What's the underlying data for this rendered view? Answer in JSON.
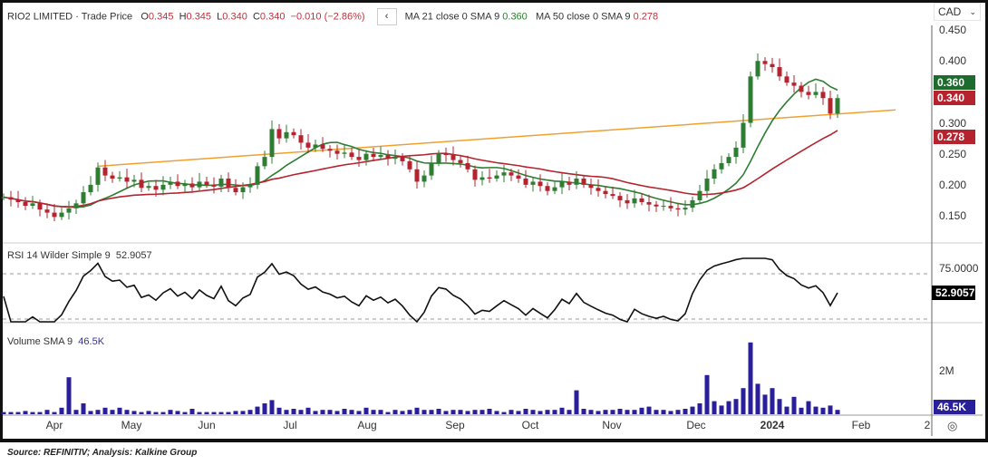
{
  "header": {
    "symbol": "RIO2 LIMITED",
    "sep": "·",
    "type": "Trade Price",
    "o_label": "O",
    "o": "0.345",
    "h_label": "H",
    "h": "0.345",
    "l_label": "L",
    "l": "0.340",
    "c_label": "C",
    "c": "0.340",
    "change": "−0.010 (−2.86%)",
    "collapse_icon": "chevron-left-icon",
    "ma21_label": "MA 21 close 0 SMA 9",
    "ma21_value": "0.360",
    "ma50_label": "MA 50 close 0 SMA 9",
    "ma50_value": "0.278"
  },
  "currency": "CAD",
  "rsi": {
    "label": "RSI 14 Wilder Simple 9",
    "value": "52.9057",
    "axis": [
      "75.0000"
    ]
  },
  "volume": {
    "label": "Volume SMA 9",
    "value": "46.5K",
    "axis": [
      "2M"
    ]
  },
  "price_axis": [
    "0.450",
    "0.400",
    "0.300",
    "0.250",
    "0.200",
    "0.150"
  ],
  "price_tags": {
    "ma21": "0.360",
    "last": "0.340",
    "ma50": "0.278"
  },
  "months": [
    "Apr",
    "May",
    "Jun",
    "Jul",
    "Aug",
    "Sep",
    "Oct",
    "Nov",
    "Dec",
    "2024",
    "Feb",
    "2"
  ],
  "settings_icon": "gear-icon",
  "source": "Source: REFINITIV; Analysis: Kalkine Group",
  "colors": {
    "up": "#2e7d32",
    "down": "#b5232e",
    "ma21": "#2e7d32",
    "ma50": "#b5232e",
    "trend": "#f0a030",
    "volume": "#2a1f9a"
  },
  "chart_data": {
    "type": "candlestick",
    "title": "RIO2 LIMITED · Trade Price",
    "ylim": [
      0.13,
      0.46
    ],
    "close": [
      0.18,
      0.176,
      0.172,
      0.166,
      0.17,
      0.16,
      0.155,
      0.148,
      0.155,
      0.162,
      0.17,
      0.188,
      0.2,
      0.228,
      0.215,
      0.21,
      0.212,
      0.205,
      0.208,
      0.195,
      0.198,
      0.192,
      0.2,
      0.205,
      0.198,
      0.202,
      0.196,
      0.205,
      0.2,
      0.197,
      0.21,
      0.195,
      0.188,
      0.196,
      0.2,
      0.23,
      0.245,
      0.29,
      0.275,
      0.285,
      0.28,
      0.268,
      0.26,
      0.265,
      0.258,
      0.255,
      0.25,
      0.252,
      0.245,
      0.24,
      0.25,
      0.245,
      0.248,
      0.242,
      0.245,
      0.238,
      0.225,
      0.205,
      0.215,
      0.235,
      0.25,
      0.248,
      0.24,
      0.235,
      0.225,
      0.208,
      0.212,
      0.21,
      0.215,
      0.22,
      0.215,
      0.21,
      0.2,
      0.205,
      0.198,
      0.19,
      0.196,
      0.205,
      0.2,
      0.21,
      0.2,
      0.195,
      0.19,
      0.185,
      0.182,
      0.175,
      0.17,
      0.178,
      0.172,
      0.168,
      0.165,
      0.166,
      0.162,
      0.16,
      0.163,
      0.175,
      0.19,
      0.21,
      0.225,
      0.235,
      0.245,
      0.26,
      0.3,
      0.375,
      0.4,
      0.395,
      0.39,
      0.375,
      0.365,
      0.36,
      0.35,
      0.345,
      0.35,
      0.34,
      0.315,
      0.34
    ],
    "volume_millions": [
      0.1,
      0.1,
      0.1,
      0.15,
      0.1,
      0.1,
      0.2,
      0.1,
      0.3,
      1.7,
      0.2,
      0.5,
      0.15,
      0.2,
      0.3,
      0.2,
      0.3,
      0.2,
      0.15,
      0.1,
      0.15,
      0.1,
      0.1,
      0.2,
      0.15,
      0.1,
      0.25,
      0.1,
      0.1,
      0.1,
      0.1,
      0.1,
      0.15,
      0.15,
      0.2,
      0.35,
      0.5,
      0.65,
      0.3,
      0.2,
      0.25,
      0.2,
      0.3,
      0.15,
      0.2,
      0.2,
      0.15,
      0.25,
      0.2,
      0.15,
      0.3,
      0.2,
      0.2,
      0.1,
      0.2,
      0.15,
      0.2,
      0.3,
      0.2,
      0.2,
      0.25,
      0.15,
      0.2,
      0.2,
      0.15,
      0.2,
      0.2,
      0.25,
      0.15,
      0.1,
      0.2,
      0.15,
      0.25,
      0.2,
      0.15,
      0.2,
      0.2,
      0.3,
      0.2,
      1.1,
      0.25,
      0.2,
      0.15,
      0.2,
      0.2,
      0.25,
      0.2,
      0.2,
      0.3,
      0.35,
      0.2,
      0.2,
      0.15,
      0.2,
      0.25,
      0.35,
      0.5,
      1.8,
      0.6,
      0.4,
      0.6,
      0.7,
      1.2,
      3.3,
      1.4,
      0.9,
      1.2,
      0.7,
      0.35,
      0.8,
      0.3,
      0.6,
      0.35,
      0.3,
      0.4,
      0.2
    ],
    "ma_periods": [
      10,
      25
    ],
    "trendline": {
      "from": [
        13,
        0.23
      ],
      "to": [
        123,
        0.321
      ]
    },
    "rsi_bands": [
      25,
      75
    ]
  }
}
